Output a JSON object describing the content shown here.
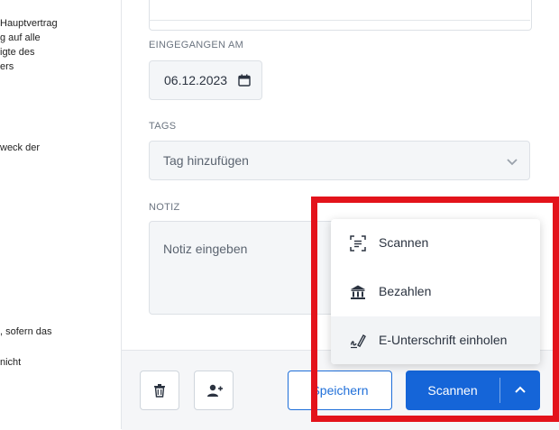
{
  "document": {
    "lines": [
      "Hauptvertrag",
      "g auf alle",
      "igte des",
      "ers",
      "weck der",
      ", sofern das",
      "nicht"
    ]
  },
  "form": {
    "received": {
      "label": "EINGEGANGEN AM",
      "value": "06.12.2023"
    },
    "tags": {
      "label": "TAGS",
      "placeholder": "Tag hinzufügen"
    },
    "note": {
      "label": "NOTIZ",
      "placeholder": "Notiz eingeben"
    }
  },
  "footer": {
    "save_label": "Speichern",
    "scan_label": "Scannen"
  },
  "menu": {
    "items": [
      {
        "label": "Scannen",
        "icon": "scan-icon"
      },
      {
        "label": "Bezahlen",
        "icon": "bank-icon"
      },
      {
        "label": "E-Unterschrift einholen",
        "icon": "signature-icon"
      }
    ]
  },
  "colors": {
    "primary": "#1565d8",
    "highlight": "#e3131b"
  }
}
